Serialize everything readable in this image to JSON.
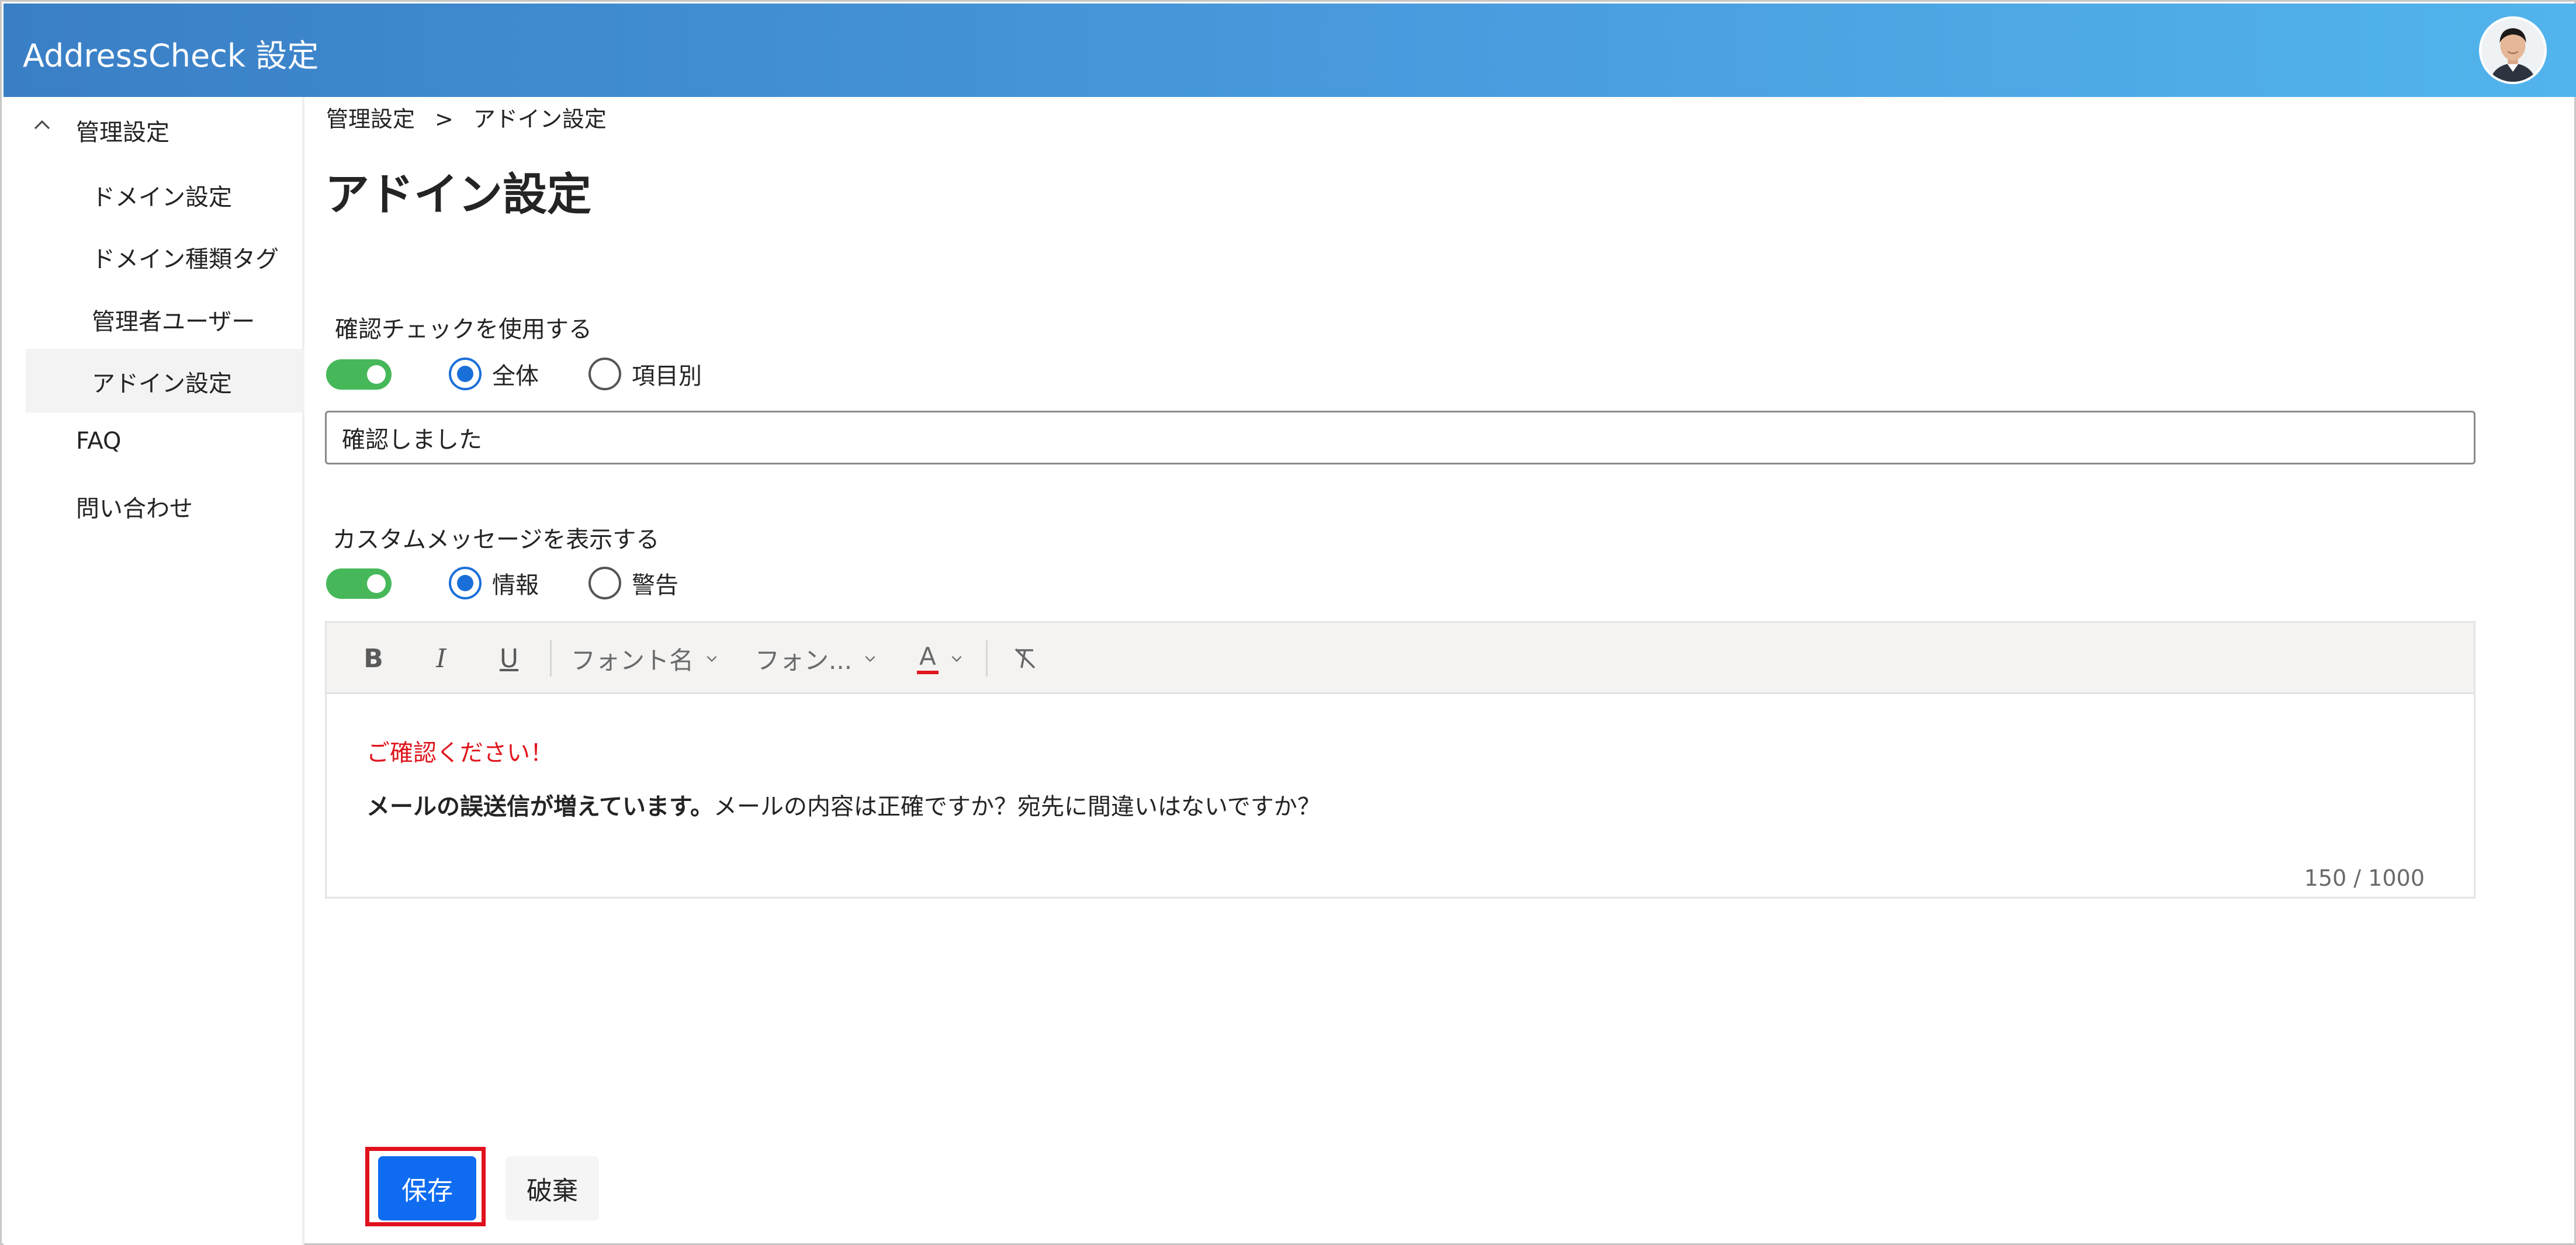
{
  "header": {
    "title": "AddressCheck 設定"
  },
  "sidebar": {
    "group_label": "管理設定",
    "sub_items": [
      "ドメイン設定",
      "ドメイン種類タグ",
      "管理者ユーザー",
      "アドイン設定"
    ],
    "active_item": "アドイン設定",
    "items": [
      "FAQ",
      "問い合わせ"
    ]
  },
  "breadcrumb": {
    "parent": "管理設定",
    "separator": ">",
    "current": "アドイン設定"
  },
  "page": {
    "title": "アドイン設定"
  },
  "confirm_check": {
    "label": "確認チェックを使用する",
    "toggle_on": true,
    "options": [
      "全体",
      "項目別"
    ],
    "selected": "全体",
    "input_value": "確認しました"
  },
  "custom_message": {
    "label": "カスタムメッセージを表示する",
    "toggle_on": true,
    "options": [
      "情報",
      "警告"
    ],
    "selected": "情報",
    "toolbar": {
      "bold": "B",
      "italic": "I",
      "underline": "U",
      "font_name": "フォント名",
      "font_size": "フォン...",
      "font_color": "A"
    },
    "content": {
      "line1": "ご確認ください！",
      "line2_bold": "メールの誤送信が増えています。",
      "line2_rest": "メールの内容は正確ですか？宛先に間違いはないですか？"
    },
    "char_count": "150 / 1000"
  },
  "actions": {
    "save": "保存",
    "discard": "破棄"
  },
  "colors": {
    "accent": "#0f6cf0",
    "toggle": "#47b85a",
    "warning_text": "#e0161d",
    "highlight": "#e0101d"
  }
}
